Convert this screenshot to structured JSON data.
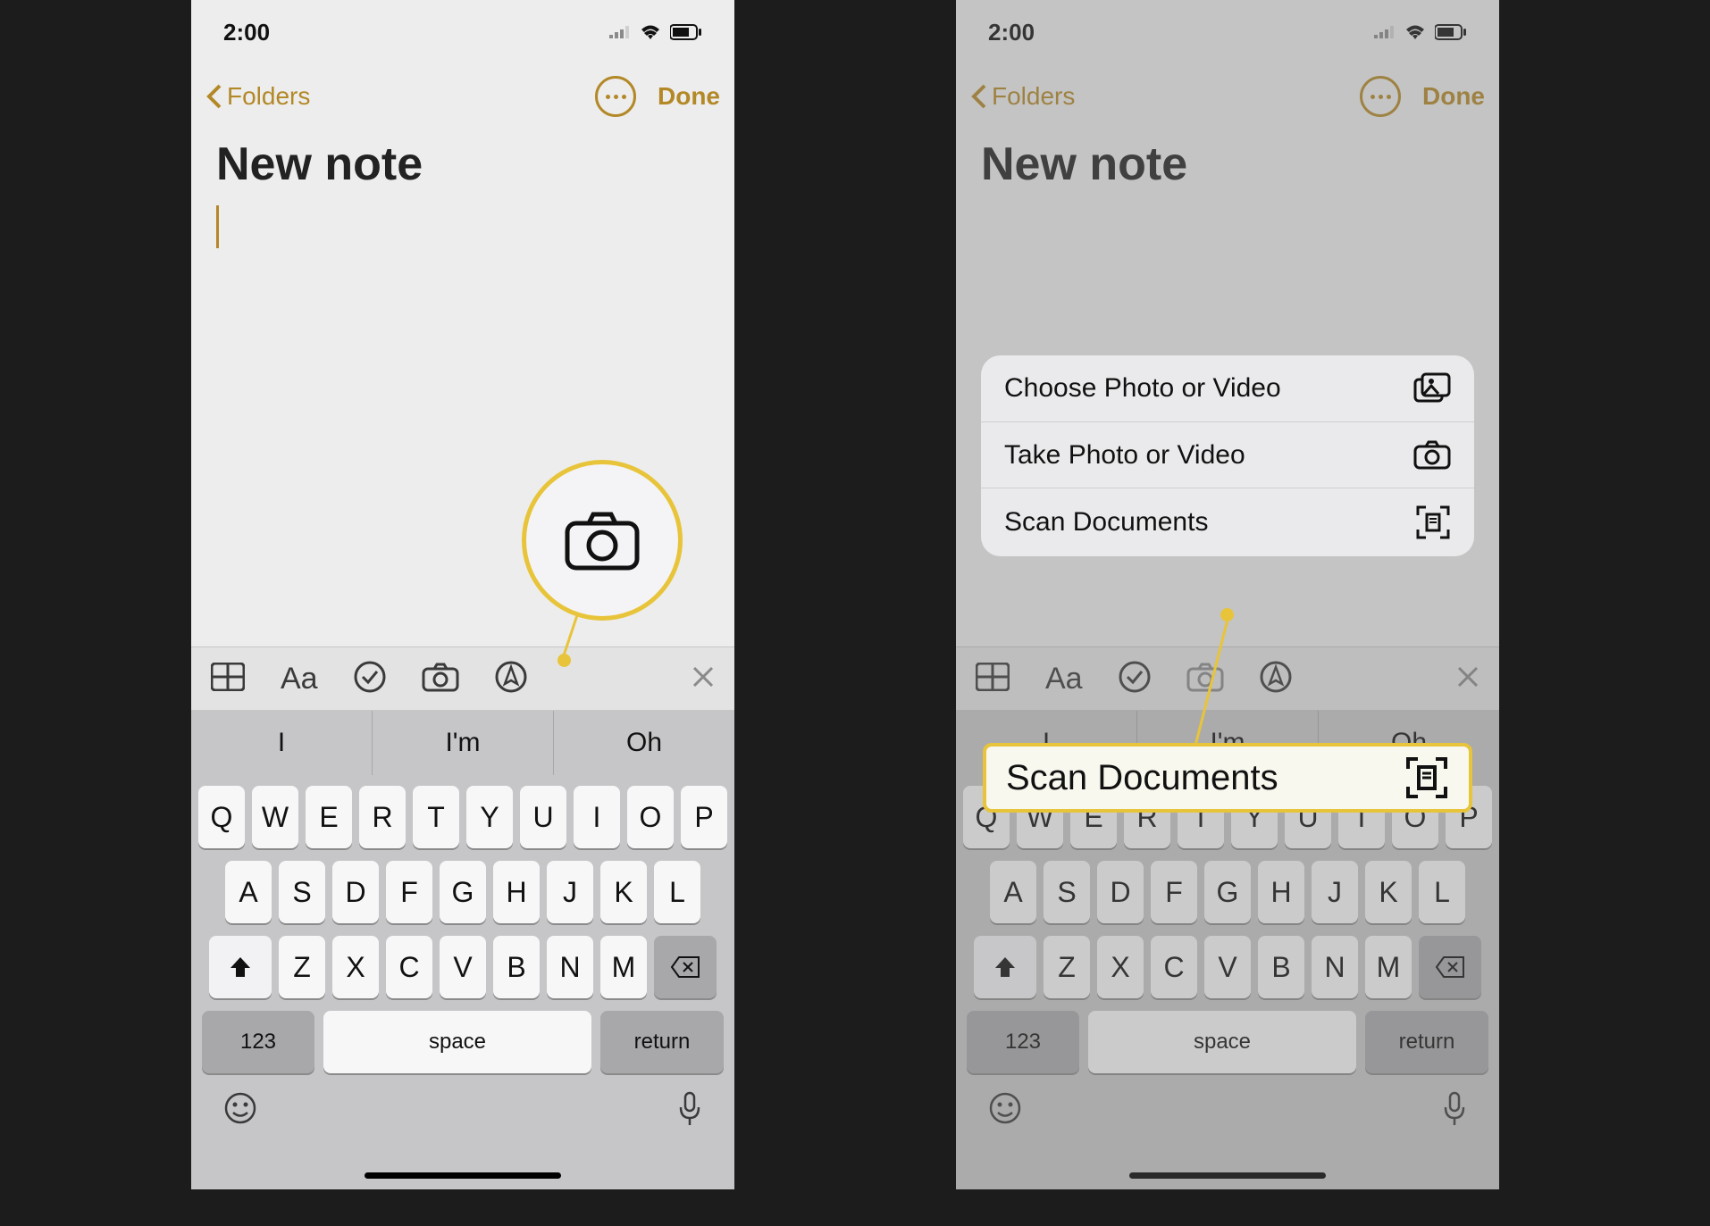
{
  "statusbar": {
    "time": "2:00"
  },
  "navbar": {
    "back_label": "Folders",
    "done_label": "Done"
  },
  "note": {
    "title": "New note"
  },
  "suggestions": [
    "I",
    "I'm",
    "Oh"
  ],
  "keyboard": {
    "row1": [
      "Q",
      "W",
      "E",
      "R",
      "T",
      "Y",
      "U",
      "I",
      "O",
      "P"
    ],
    "row2": [
      "A",
      "S",
      "D",
      "F",
      "G",
      "H",
      "J",
      "K",
      "L"
    ],
    "row3": [
      "Z",
      "X",
      "C",
      "V",
      "B",
      "N",
      "M"
    ],
    "num_label": "123",
    "space_label": "space",
    "return_label": "return"
  },
  "camera_menu": {
    "choose": "Choose Photo or Video",
    "take": "Take Photo or Video",
    "scan": "Scan Documents"
  },
  "callout": {
    "scan_label": "Scan Documents"
  }
}
